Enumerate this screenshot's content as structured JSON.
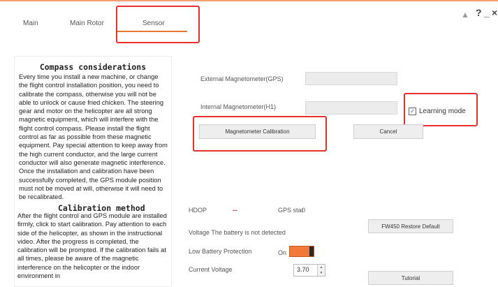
{
  "tabs": [
    {
      "label": "Main"
    },
    {
      "label": "Main Rotor"
    },
    {
      "label": "Sensor"
    }
  ],
  "window_controls": {
    "help": "?",
    "minimize": "_",
    "close": "×"
  },
  "panel": {
    "compass_title": "Compass considerations",
    "compass_text": "Every time you install a new machine, or change the flight control installation position, you need to calibrate the compass, otherwise you will not be able to unlock or cause fried chicken. The steering gear and motor on the helicopter are all strong magnetic equipment, which will interfere with the flight control compass. Please install the flight control as far as possible from these magnetic equipment. Pay special attention to keep away from the high current conductor, and the large current conductor will also generate magnetic interference. Once the installation and calibration have been successfully completed, the GPS module position must not be moved at will, otherwise it will need to be recalibrated.",
    "calibration_title": "Calibration method",
    "calibration_text": "After the flight control and GPS module are installed firmly, click to start calibration. Pay attention to each side of the helicopter, as shown in the instructional video. After the progress is completed, the calibration will be prompted. If the calibration fails at all times, please be aware of the magnetic interference on the helicopter or the indoor environment in"
  },
  "sensor": {
    "external_label": "External Magnetometer(GPS)",
    "internal_label": "Internal Magnetometer(H1)",
    "learning_mode": "Learning mode",
    "calibration_button": "Magnetometer Calibration",
    "cancel_button": "Cancel",
    "hdop_label": "HDOP",
    "hdop_value": "--",
    "gps_star_label": "GPS star",
    "gps_star_value": "0",
    "restore_button": "FW450 Restore Default",
    "voltage_text": "Voltage  The battery is not detected",
    "low_battery_label": "Low Battery Protection",
    "low_battery_state": "On",
    "current_voltage_label": "Current Voltage",
    "current_voltage_value": "3.70",
    "tutorial_button": "Tutorial"
  },
  "colors": {
    "accent": "#e87830",
    "highlight": "#e53030"
  }
}
